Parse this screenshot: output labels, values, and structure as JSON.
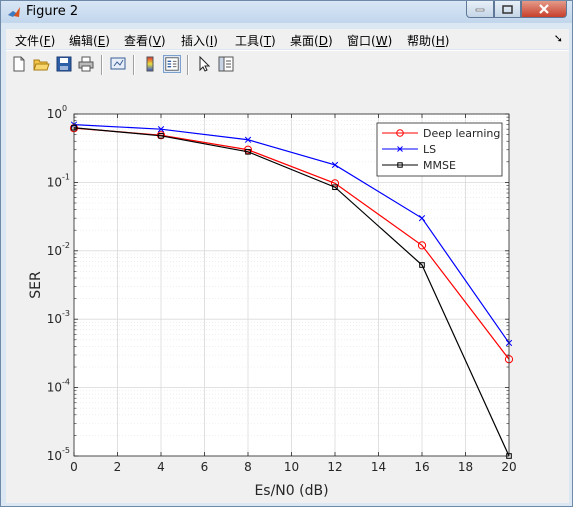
{
  "window": {
    "title": "Figure 2"
  },
  "menu": [
    {
      "label": "文件(",
      "key": "F",
      "suffix": ")"
    },
    {
      "label": "编辑(",
      "key": "E",
      "suffix": ")"
    },
    {
      "label": "查看(",
      "key": "V",
      "suffix": ")"
    },
    {
      "label": "插入(",
      "key": "I",
      "suffix": ")"
    },
    {
      "label": "工具(",
      "key": "T",
      "suffix": ")"
    },
    {
      "label": "桌面(",
      "key": "D",
      "suffix": ")"
    },
    {
      "label": "窗口(",
      "key": "W",
      "suffix": ")"
    },
    {
      "label": "帮助(",
      "key": "H",
      "suffix": ")"
    }
  ],
  "toolbar": [
    "new-figure-icon",
    "open-file-icon",
    "save-icon",
    "print-icon",
    "link-plot-icon",
    "colorbar-icon",
    "legend-icon",
    "pointer-icon",
    "property-inspector-icon"
  ],
  "chart_data": {
    "type": "line",
    "xlabel": "Es/N0 (dB)",
    "ylabel": "SER",
    "xlim": [
      0,
      20
    ],
    "ylim": [
      1e-05,
      1
    ],
    "yscale": "log",
    "grid": true,
    "legend_position": "top-right",
    "x_ticks": [
      "0",
      "2",
      "4",
      "6",
      "8",
      "10",
      "12",
      "14",
      "16",
      "18",
      "20"
    ],
    "y_tick_exponents": [
      "0",
      "-1",
      "-2",
      "-3",
      "-4",
      "-5"
    ],
    "x": [
      0,
      4,
      8,
      12,
      16,
      20
    ],
    "series": [
      {
        "name": "Deep learning",
        "color": "#ff0000",
        "marker": "circle",
        "values": [
          0.62,
          0.49,
          0.3,
          0.097,
          0.012,
          0.00026
        ]
      },
      {
        "name": "LS",
        "color": "#0000ff",
        "marker": "x",
        "values": [
          0.7,
          0.6,
          0.42,
          0.18,
          0.03,
          0.00045
        ]
      },
      {
        "name": "MMSE",
        "color": "#000000",
        "marker": "square",
        "values": [
          0.63,
          0.48,
          0.28,
          0.085,
          0.0062,
          1e-05
        ]
      }
    ]
  }
}
